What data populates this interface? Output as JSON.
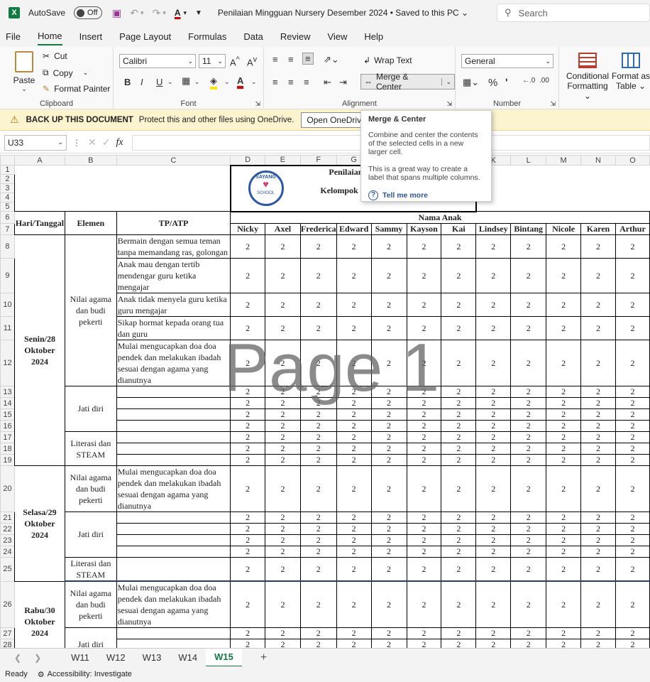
{
  "titlebar": {
    "app_icon": "X",
    "autosave_label": "AutoSave",
    "autosave_state": "Off",
    "doc_title": "Penilaian Mingguan Nursery Desember 2024",
    "save_state": "Saved to this PC",
    "search_placeholder": "Search"
  },
  "menu": [
    "File",
    "Home",
    "Insert",
    "Page Layout",
    "Formulas",
    "Data",
    "Review",
    "View",
    "Help"
  ],
  "ribbon": {
    "clipboard": {
      "label": "Clipboard",
      "paste": "Paste",
      "cut": "Cut",
      "copy": "Copy",
      "format_painter": "Format Painter"
    },
    "font": {
      "label": "Font",
      "name": "Calibri",
      "size": "11"
    },
    "alignment": {
      "label": "Alignment",
      "wrap": "Wrap Text",
      "merge": "Merge & Center"
    },
    "number": {
      "label": "Number",
      "format": "General"
    },
    "styles": {
      "conditional_l1": "Conditional",
      "conditional_l2": "Formatting",
      "format_l1": "Format as",
      "format_l2": "Table"
    }
  },
  "msgbar": {
    "title": "BACK UP THIS DOCUMENT",
    "text": "Protect this and other files using OneDrive.",
    "button": "Open OneDrive"
  },
  "tooltip": {
    "title": "Merge & Center",
    "p1": "Combine and center the contents of the selected cells in a new larger cell.",
    "p2": "This is a great way to create a label that spans multiple columns.",
    "link": "Tell me more"
  },
  "formulabar": {
    "namebox": "U33",
    "fx": "fx",
    "value": ""
  },
  "sheet": {
    "col_letters": [
      "",
      "A",
      "B",
      "C",
      "D",
      "E",
      "F",
      "G",
      "H",
      "I",
      "J",
      "K",
      "L",
      "M",
      "N",
      "O"
    ],
    "title_line1": "Penilaian",
    "title_line2": "Kelompok B",
    "logo_text": "SAYANG",
    "logo_sub": "SCHOOL",
    "hdr_day": "Hari/Tanggal",
    "hdr_elemen": "Elemen",
    "hdr_tp": "TP/ATP",
    "hdr_nama": "Nama Anak",
    "names": [
      "Nicky",
      "Axel",
      "Frederica",
      "Edward",
      "Sammy",
      "Kayson",
      "Kai",
      "Lindsey",
      "Bintang",
      "Nicole",
      "Karen",
      "Arthur"
    ],
    "day1": "Senin/28 Oktober 2024",
    "day2": "Selasa/29 Oktober 2024",
    "day3": "Rabu/30 Oktober 2024",
    "el_nab": "Nilai agama dan budi pekerti",
    "el_jd": "Jati diri",
    "el_ls": "Literasi dan STEAM",
    "tp8": "Bermain dengan semua teman tanpa memandang ras, golongan",
    "tp9": "Anak mau dengan tertib mendengar guru ketika mengajar",
    "tp10": "Anak tidak menyela guru ketika guru mengajar",
    "tp11": "Sikap hormat kepada orang tua dan guru",
    "tp12": "Mulai mengucapkan doa doa pendek dan melakukan ibadah sesuai dengan agama yang dianutnya",
    "score": "2",
    "watermark": "Page 1"
  },
  "sheettabs": [
    "W11",
    "W12",
    "W13",
    "W14",
    "W15"
  ],
  "active_tab": "W15",
  "statusbar": {
    "ready": "Ready",
    "accessibility": "Accessibility: Investigate"
  }
}
